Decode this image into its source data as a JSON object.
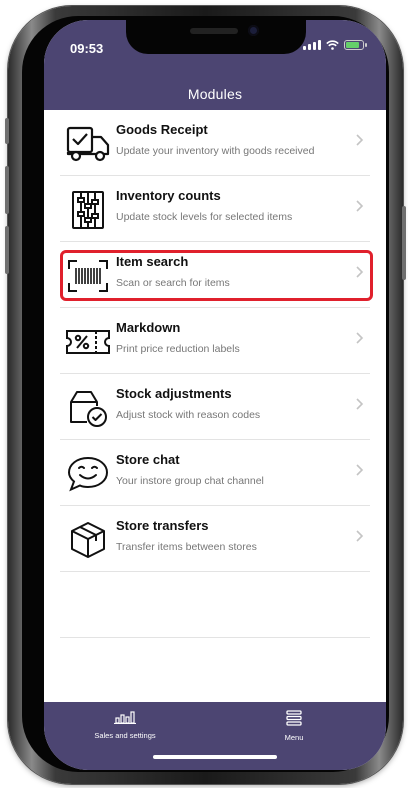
{
  "status_bar": {
    "time": "09:53"
  },
  "header": {
    "title": "Modules"
  },
  "modules": [
    {
      "title": "Goods Receipt",
      "subtitle": "Update your inventory with goods received",
      "icon": "truck-check-icon"
    },
    {
      "title": "Inventory counts",
      "subtitle": "Update stock levels for selected items",
      "icon": "abacus-icon"
    },
    {
      "title": "Item search",
      "subtitle": "Scan or search for items",
      "icon": "barcode-scan-icon",
      "highlighted": true
    },
    {
      "title": "Markdown",
      "subtitle": "Print price reduction labels",
      "icon": "percent-tag-icon"
    },
    {
      "title": "Stock adjustments",
      "subtitle": "Adjust stock with reason codes",
      "icon": "box-check-icon"
    },
    {
      "title": "Store chat",
      "subtitle": "Your instore group chat channel",
      "icon": "smiley-chat-icon"
    },
    {
      "title": "Store transfers",
      "subtitle": "Transfer items between stores",
      "icon": "package-icon"
    }
  ],
  "bottom_nav": [
    {
      "label": "Sales and settings",
      "icon": "bar-chart-icon"
    },
    {
      "label": "Menu",
      "icon": "hamburger-menu-icon"
    }
  ],
  "colors": {
    "header": "#4c4572",
    "highlight": "#e0202c"
  }
}
